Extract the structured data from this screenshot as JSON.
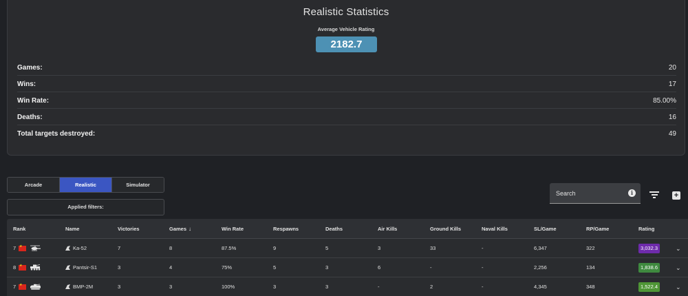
{
  "stats": {
    "title": "Realistic Statistics",
    "avr_label": "Average Vehicle Rating",
    "avr_value": "2182.7",
    "rows": [
      {
        "label": "Games:",
        "value": "20"
      },
      {
        "label": "Wins:",
        "value": "17"
      },
      {
        "label": "Win Rate:",
        "value": "85.00%"
      },
      {
        "label": "Deaths:",
        "value": "16"
      },
      {
        "label": "Total targets destroyed:",
        "value": "49"
      }
    ]
  },
  "mode_tabs": [
    {
      "label": "Arcade",
      "active": false
    },
    {
      "label": "Realistic",
      "active": true
    },
    {
      "label": "Simulator",
      "active": false
    }
  ],
  "filters": {
    "label": "Applied filters:"
  },
  "search": {
    "placeholder": "Search",
    "info_icon": "info-icon"
  },
  "toolbar": {
    "filter_icon": "filter-icon",
    "add_icon": "add-icon"
  },
  "table": {
    "columns": [
      "Rank",
      "Name",
      "Victories",
      "Games",
      "Win Rate",
      "Respawns",
      "Deaths",
      "Air Kills",
      "Ground Kills",
      "Naval Kills",
      "SL/Game",
      "RP/Game",
      "Rating"
    ],
    "sort_indicator": "↓",
    "rows": [
      {
        "rank": "7",
        "name": "Ka-52",
        "victories": "7",
        "games": "8",
        "win_rate": "87.5%",
        "respawns": "9",
        "deaths": "5",
        "air_kills": "3",
        "ground_kills": "33",
        "naval_kills": "-",
        "sl_game": "6,347",
        "rp_game": "322",
        "rating": "3,032.3",
        "rating_color": "#6e2bab",
        "vehicle_icon": "helicopter-icon"
      },
      {
        "rank": "8",
        "name": "Pantsir-S1",
        "victories": "3",
        "games": "4",
        "win_rate": "75%",
        "respawns": "5",
        "deaths": "3",
        "air_kills": "6",
        "ground_kills": "-",
        "naval_kills": "-",
        "sl_game": "2,256",
        "rp_game": "134",
        "rating": "1,838.6",
        "rating_color": "#3f8a3f",
        "vehicle_icon": "spaa-truck-icon"
      },
      {
        "rank": "7",
        "name": "BMP-2M",
        "victories": "3",
        "games": "3",
        "win_rate": "100%",
        "respawns": "3",
        "deaths": "3",
        "air_kills": "-",
        "ground_kills": "2",
        "naval_kills": "-",
        "sl_game": "4,345",
        "rp_game": "348",
        "rating": "1,522.4",
        "rating_color": "#4f9636",
        "vehicle_icon": "ifv-icon"
      }
    ]
  },
  "colors": {
    "accent": "#3b56c2",
    "avr_badge": "#4d91b4",
    "flag": "#d8261c"
  }
}
